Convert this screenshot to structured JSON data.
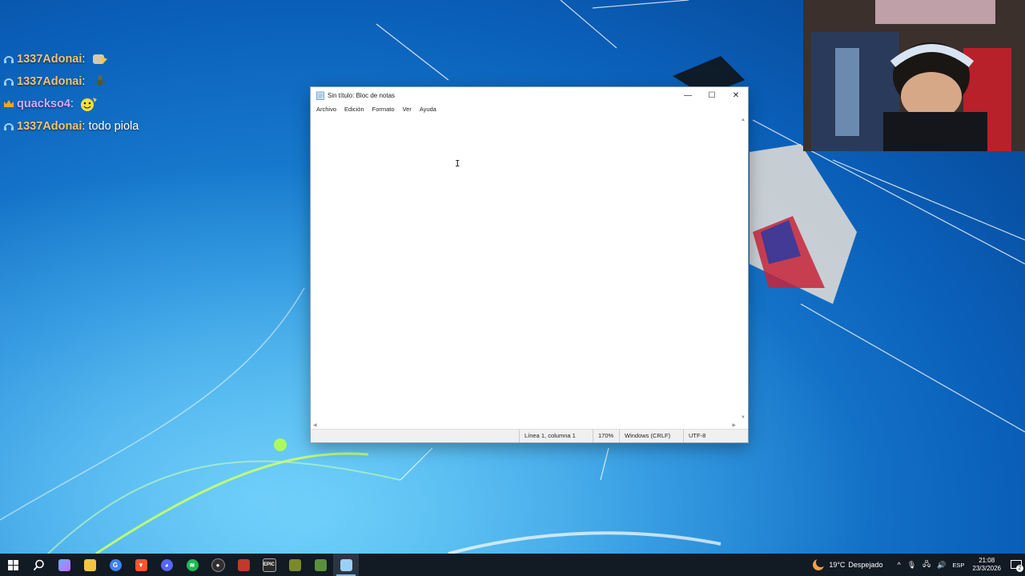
{
  "chat": {
    "messages": [
      {
        "user": "1337Adonai",
        "user_color": "#f2c46d",
        "badge": "headphones-icon",
        "text": "",
        "emote": "cat-emote"
      },
      {
        "user": "1337Adonai",
        "user_color": "#f2c46d",
        "badge": "headphones-icon",
        "text": "",
        "emote": "dancing-figure-emote"
      },
      {
        "user": "quackso4",
        "user_color": "#d8a8ff",
        "badge": "crown-icon",
        "text": "",
        "emote": "smiley-emote"
      },
      {
        "user": "1337Adonai",
        "user_color": "#f2c46d",
        "badge": "headphones-icon",
        "text": "todo piola",
        "emote": ""
      }
    ]
  },
  "notepad": {
    "title": "Sin título: Bloc de notas",
    "menu": [
      "Archivo",
      "Edición",
      "Formato",
      "Ver",
      "Ayuda"
    ],
    "controls": {
      "minimize": "—",
      "maximize": "☐",
      "close": "✕"
    },
    "content": "",
    "status": {
      "position": "Línea 1, columna 1",
      "zoom": "170%",
      "line_ending": "Windows (CRLF)",
      "encoding": "UTF-8"
    }
  },
  "taskbar": {
    "apps": [
      {
        "name": "start-button",
        "icon": "windows-logo-icon",
        "color": "#ffffff"
      },
      {
        "name": "search-button",
        "icon": "search-icon",
        "color": "#ffffff"
      },
      {
        "name": "copilot-button",
        "icon": "copilot-icon",
        "color": "#6ab0ff"
      },
      {
        "name": "file-explorer-button",
        "icon": "folder-icon",
        "color": "#f5c542"
      },
      {
        "name": "chrome-like-button",
        "icon": "browser-g-icon",
        "color": "#3b82f6"
      },
      {
        "name": "brave-button",
        "icon": "brave-icon",
        "color": "#fb542b"
      },
      {
        "name": "discord-button",
        "icon": "discord-icon",
        "color": "#5865f2"
      },
      {
        "name": "spotify-button",
        "icon": "spotify-icon",
        "color": "#1db954"
      },
      {
        "name": "obs-button",
        "icon": "obs-icon",
        "color": "#302e31"
      },
      {
        "name": "voicemod-button",
        "icon": "voice-app-icon",
        "color": "#c0392b"
      },
      {
        "name": "epic-games-button",
        "icon": "epic-games-icon",
        "color": "#2a2a2a"
      },
      {
        "name": "game-button",
        "icon": "game-icon",
        "color": "#7a8a2a"
      },
      {
        "name": "minecraft-button",
        "icon": "minecraft-icon",
        "color": "#5a8f3c"
      },
      {
        "name": "notepad-button",
        "icon": "notepad-icon",
        "color": "#9ad0f5"
      }
    ],
    "weather": {
      "temp": "19°C",
      "condition": "Despejado"
    },
    "language": "ESP",
    "time": "21:08",
    "date": "23/3/2026",
    "notifications": "2"
  }
}
